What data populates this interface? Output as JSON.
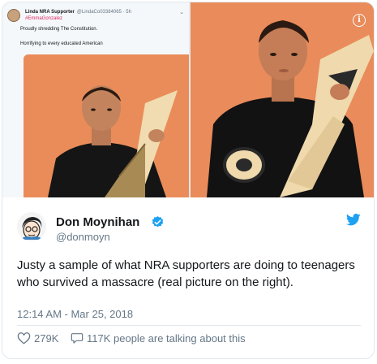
{
  "embedded_tweet": {
    "name": "Linda NRA Supporter",
    "handle": "@LindaCo03384065 · 5h",
    "hashtag": "#EmmaGonzalez",
    "line1": "Proudly shredding The Constitution.",
    "line2": "Horrifying to every educated American",
    "menu_icon": "chevron-down-icon"
  },
  "info_icon": "info-icon",
  "author": {
    "name": "Don Moynihan",
    "handle": "@donmoyn",
    "verified": true
  },
  "tweet": {
    "text": "Justy a sample of what NRA supporters are doing to teenagers who survived a massacre (real picture on the right).",
    "timestamp": "12:14 AM - Mar 25, 2018"
  },
  "actions": {
    "likes": "279K",
    "replies_label": "117K people are talking about this"
  },
  "colors": {
    "brand": "#1da1f2",
    "text": "#14171a",
    "muted": "#657786",
    "background_photo": "#e98b5a"
  }
}
